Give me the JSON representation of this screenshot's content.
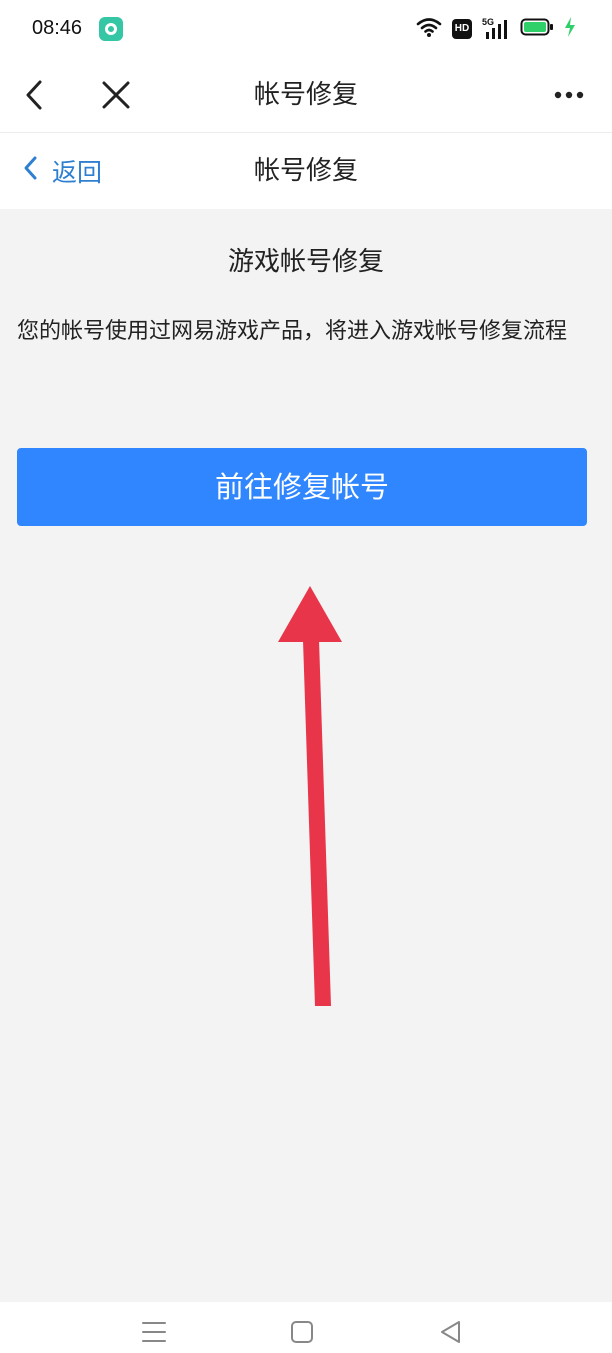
{
  "status_bar": {
    "time": "08:46",
    "app_icon": "chat-bubble-icon",
    "hd_label": "HD",
    "network_label": "5G",
    "icons": [
      "wifi-icon",
      "hd-icon",
      "signal-icon",
      "battery-icon",
      "charging-icon"
    ],
    "battery_color": "#2fcf6a"
  },
  "nav": {
    "title": "帐号修复",
    "back_icon": "chevron-left-icon",
    "close_icon": "close-icon",
    "more_icon": "more-dots-icon"
  },
  "sub_nav": {
    "back_label": "返回",
    "title": "帐号修复",
    "accent": "#2f7fd1"
  },
  "main": {
    "section_title": "游戏帐号修复",
    "description": "您的帐号使用过网易游戏产品，将进入游戏帐号修复流程",
    "button_label": "前往修复帐号",
    "button_color": "#2f86ff",
    "annotation_icon": "red-arrow-up-icon",
    "annotation_color": "#e8354a"
  },
  "system_nav": {
    "icons": [
      "menu-icon",
      "home-square-icon",
      "back-triangle-icon"
    ]
  }
}
